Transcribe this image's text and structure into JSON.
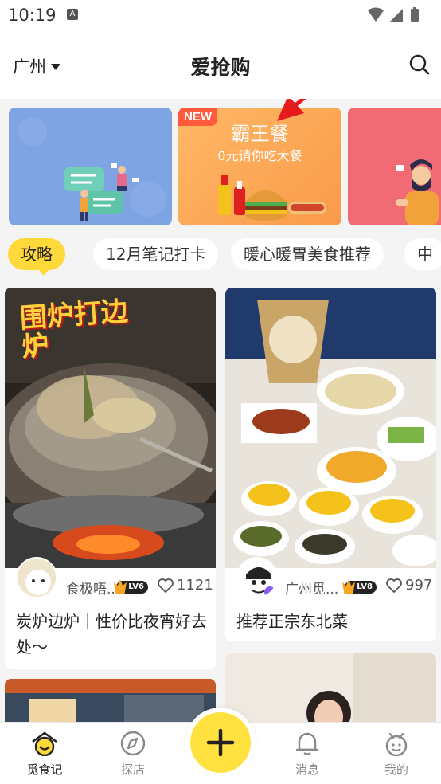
{
  "status_bar": {
    "time": "10:19"
  },
  "header": {
    "city": "广州",
    "title": "爱抢购"
  },
  "banners": [
    {
      "kind": "illustration"
    },
    {
      "badge": "NEW",
      "title": "霸王餐",
      "subtitle": "0元请你吃大餐"
    },
    {
      "kind": "illustration"
    }
  ],
  "tags": [
    "攻略",
    "12月笔记打卡",
    "暖心暖胃美食推荐",
    "中"
  ],
  "feed": [
    {
      "photo_text": "围炉打边炉",
      "author": "食极唔...",
      "level": "LV6",
      "likes": "1121",
      "title": "炭炉边炉｜性价比夜宵好去处～"
    },
    {
      "author": "广州觅...",
      "level": "LV8",
      "likes": "997",
      "title": "推荐正宗东北菜"
    }
  ],
  "tabbar": [
    {
      "label": "觅食记",
      "icon": "home-face-icon",
      "active": true
    },
    {
      "label": "探店",
      "icon": "compass-icon",
      "active": false
    },
    {
      "label": "消息",
      "icon": "bell-icon",
      "active": false
    },
    {
      "label": "我的",
      "icon": "profile-face-icon",
      "active": false
    }
  ],
  "colors": {
    "accent": "#ffd93a",
    "new_badge": "#ff5a3c",
    "arrow": "#e8191c"
  }
}
